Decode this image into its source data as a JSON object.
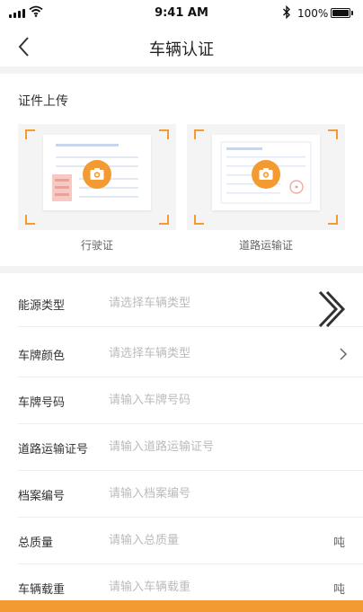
{
  "status_bar": {
    "time": "9:41 AM",
    "battery": "100%"
  },
  "nav": {
    "title": "车辆认证"
  },
  "upload": {
    "section_title": "证件上传",
    "cards": [
      {
        "label": "行驶证",
        "icon": "camera-icon"
      },
      {
        "label": "道路运输证",
        "icon": "camera-icon"
      }
    ]
  },
  "form": {
    "rows": [
      {
        "label": "能源类型",
        "placeholder": "请选择车辆类型",
        "trailing": "chevron-right-icon"
      },
      {
        "label": "车牌颜色",
        "placeholder": "请选择车辆类型",
        "trailing": "chevron-right-icon"
      },
      {
        "label": "车牌号码",
        "placeholder": "请输入车牌号码"
      },
      {
        "label": "道路运输证号",
        "placeholder": "请输入道路运输证号"
      },
      {
        "label": "档案编号",
        "placeholder": "请输入档案编号"
      },
      {
        "label": "总质量",
        "placeholder": "请输入总质量",
        "unit": "吨"
      },
      {
        "label": "车辆载重",
        "placeholder": "请输入车辆载重",
        "unit": "吨"
      }
    ]
  },
  "colors": {
    "accent": "#f39a32",
    "band": "#f3f3f3",
    "placeholder": "#bbbbbb"
  }
}
